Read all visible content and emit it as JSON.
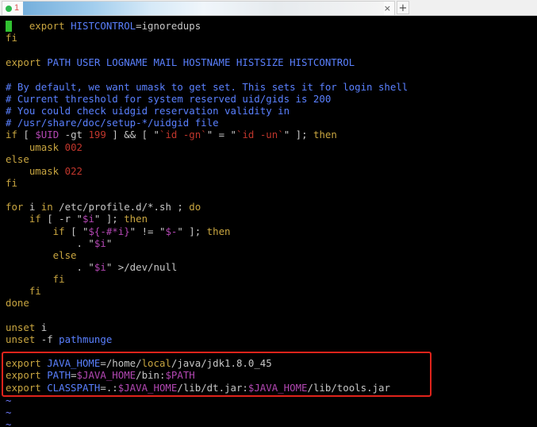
{
  "tabbar": {
    "tab_number": "1",
    "close_label": "×",
    "add_label": "+"
  },
  "colors": {
    "keyword": "#c8a540",
    "comment": "#5a80ff",
    "variable": "#b347b3",
    "number": "#c0362c",
    "highlight_border": "#e0231b",
    "cursor": "#31c131"
  },
  "editor": {
    "l1": {
      "a": "    export ",
      "b": "HISTCONTROL",
      "c": "=ignoredups"
    },
    "l2": {
      "a": "fi"
    },
    "l4": {
      "a": "export ",
      "b": "PATH USER LOGNAME MAIL HOSTNAME HISTSIZE HISTCONTROL"
    },
    "l6": "# By default, we want umask to get set. This sets it for login shell",
    "l7": "# Current threshold for system reserved uid/gids is 200",
    "l8": "# You could check uidgid reservation validity in",
    "l9": "# /usr/share/doc/setup-*/uidgid file",
    "l10": {
      "a": "if",
      "b": " [ ",
      "c": "$UID",
      "d": " -gt ",
      "e": "199",
      "f": " ] && [ \"",
      "g": "`id -gn`",
      "h": "\" = \"",
      "i": "`id -un`",
      "j": "\" ]; ",
      "k": "then"
    },
    "l11": {
      "a": "    umask ",
      "b": "002"
    },
    "l12": {
      "a": "else"
    },
    "l13": {
      "a": "    umask ",
      "b": "022"
    },
    "l14": {
      "a": "fi"
    },
    "l16": {
      "a": "for",
      "b": " i ",
      "c": "in",
      "d": " /etc/profile.d/*.sh ; ",
      "e": "do"
    },
    "l17": {
      "a": "    if",
      "b": " [ -r \"",
      "c": "$i",
      "d": "\" ]; ",
      "e": "then"
    },
    "l18": {
      "a": "        if",
      "b": " [ \"",
      "c": "${-#*i}",
      "d": "\" != \"",
      "e": "$-",
      "f": "\" ]; ",
      "g": "then"
    },
    "l19": {
      "a": "            . \"",
      "b": "$i",
      "c": "\""
    },
    "l20": {
      "a": "        else"
    },
    "l21": {
      "a": "            . \"",
      "b": "$i",
      "c": "\" >/dev/null"
    },
    "l22": {
      "a": "        fi"
    },
    "l23": {
      "a": "    fi"
    },
    "l24": {
      "a": "done"
    },
    "l26": {
      "a": "unset",
      "b": " i"
    },
    "l27": {
      "a": "unset",
      "b": " -f ",
      "c": "pathmunge"
    },
    "l29": {
      "a": "export ",
      "b": "JAVA_HOME",
      "c": "=/home/",
      "d": "local",
      "e": "/java/jdk1.8.0_45"
    },
    "l30": {
      "a": "export ",
      "b": "PATH",
      "c": "=",
      "d": "$JAVA_HOME",
      "e": "/bin:",
      "f": "$PATH"
    },
    "l31": {
      "a": "export ",
      "b": "CLASSPATH",
      "c": "=.:",
      "d": "$JAVA_HOME",
      "e": "/lib/dt.jar:",
      "f": "$JAVA_HOME",
      "g": "/lib/tools.jar"
    },
    "tilde": "~"
  }
}
